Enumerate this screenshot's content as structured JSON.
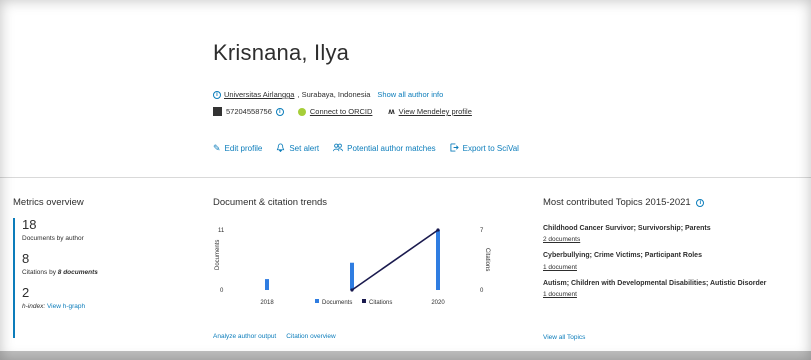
{
  "author": {
    "name": "Krisnana, Ilya",
    "affiliation": "Universitas Airlangga",
    "location": ", Surabaya, Indonesia",
    "show_info": "Show all author info",
    "scopus_id": "57204558756",
    "orcid_link": "Connect to ORCID",
    "mendeley_link": "View Mendeley profile"
  },
  "actions": [
    {
      "icon": "pencil-icon",
      "label": "Edit profile"
    },
    {
      "icon": "bell-icon",
      "label": "Set alert"
    },
    {
      "icon": "people-icon",
      "label": "Potential author matches"
    },
    {
      "icon": "export-icon",
      "label": "Export to SciVal"
    }
  ],
  "metrics": {
    "title": "Metrics overview",
    "documents_value": "18",
    "documents_label": "Documents by author",
    "citations_value": "8",
    "citations_label_pre": "Citations by ",
    "citations_label_bold": "8 documents",
    "hindex_value": "2",
    "hindex_label": "h-index:",
    "hindex_link": "View h-graph"
  },
  "trends": {
    "title": "Document & citation trends",
    "analyze_link": "Analyze author output",
    "citation_link": "Citation overview"
  },
  "chart_data": {
    "type": "bar",
    "categories": [
      "2018",
      "2019",
      "2020"
    ],
    "x_ticks": [
      "2018",
      "2020"
    ],
    "series": [
      {
        "name": "Documents",
        "kind": "bar",
        "axis": "left",
        "color": "#2f7de1",
        "values": [
          2,
          5,
          11
        ]
      },
      {
        "name": "Citations",
        "kind": "line",
        "axis": "right",
        "color": "#1a1a4e",
        "values": [
          null,
          0,
          7
        ]
      }
    ],
    "y_left": {
      "label": "Documents",
      "ticks": [
        "11",
        "0"
      ],
      "max": 11
    },
    "y_right": {
      "label": "Citations",
      "ticks": [
        "7",
        "0"
      ],
      "max": 7
    },
    "legend": "bottom"
  },
  "topics": {
    "title": "Most contributed Topics 2015-2021",
    "items": [
      {
        "title": "Childhood Cancer Survivor; Survivorship; Parents",
        "docs": "2 documents"
      },
      {
        "title": "Cyberbullying; Crime Victims; Participant Roles",
        "docs": "1 document"
      },
      {
        "title": "Autism; Children with Developmental Disabilities; Autistic Disorder",
        "docs": "1 document"
      }
    ],
    "view_all": "View all Topics"
  }
}
